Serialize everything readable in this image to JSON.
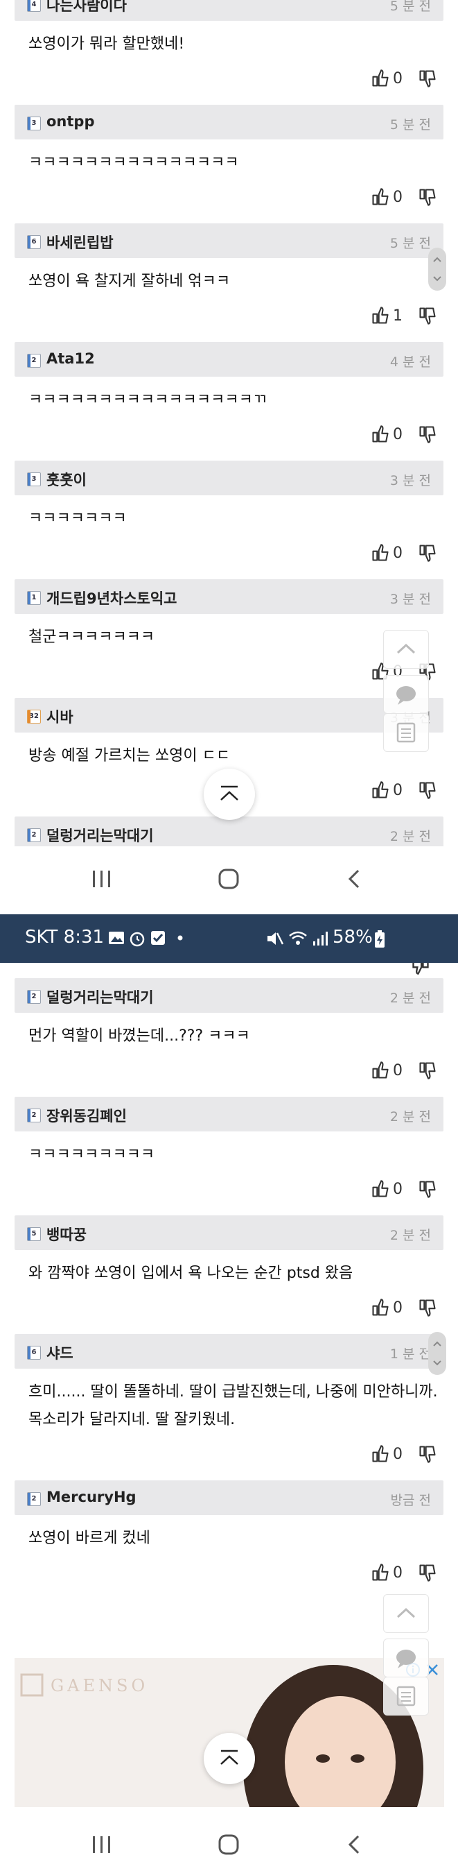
{
  "colors": {
    "statusbar_bg": "#283f5c",
    "header_bg": "#e8e8ea",
    "level_blue": "#4a7fc7",
    "level_orange": "#e68a2e"
  },
  "comments_top": [
    {
      "level": "4",
      "level_color": "blue",
      "nickname": "나는사람이다",
      "time": "5 분 전",
      "text": "쏘영이가 뭐라 할만했네!",
      "likes": "0"
    },
    {
      "level": "3",
      "level_color": "blue",
      "nickname": "ontpp",
      "time": "5 분 전",
      "text": "ㅋㅋㅋㅋㅋㅋㅋㅋㅋㅋㅋㅋㅋㅋㅋ",
      "likes": "0"
    },
    {
      "level": "6",
      "level_color": "blue",
      "nickname": "바세린립밥",
      "time": "5 분 전",
      "text": "쏘영이 욕 찰지게 잘하네 얶ㅋㅋ",
      "likes": "1"
    },
    {
      "level": "2",
      "level_color": "blue",
      "nickname": "Ata12",
      "time": "4 분 전",
      "text": "ㅋㅋㅋㅋㅋㅋㅋㅋㅋㅋㅋㅋㅋㅋㅋㅋㄲ",
      "likes": "0"
    },
    {
      "level": "3",
      "level_color": "blue",
      "nickname": "훗훗이",
      "time": "3 분 전",
      "text": "ㅋㅋㅋㅋㅋㅋㅋ",
      "likes": "0"
    },
    {
      "level": "1",
      "level_color": "blue",
      "nickname": "개드립9년차스토익고",
      "time": "3 분 전",
      "text": "철군ㅋㅋㅋㅋㅋㅋㅋ",
      "likes": "0"
    },
    {
      "level": "32",
      "level_color": "orange",
      "nickname": "시바",
      "time": "3 분 전",
      "text": "방송 예절 가르치는 쏘영이 ㄷㄷ",
      "likes": "0"
    },
    {
      "level": "2",
      "level_color": "blue",
      "nickname": "덜렁거리는막대기",
      "time": "2 분 전",
      "text": "",
      "likes": ""
    }
  ],
  "status_bar": {
    "carrier_time": "SKT 8:31",
    "battery": "58%"
  },
  "comments_bottom": [
    {
      "level": "2",
      "level_color": "blue",
      "nickname": "덜렁거리는막대기",
      "time": "2 분 전",
      "text": "먼가 역할이 바꼈는데...??? ㅋㅋㅋ",
      "likes": "0"
    },
    {
      "level": "2",
      "level_color": "blue",
      "nickname": "장위동김폐인",
      "time": "2 분 전",
      "text": "ㅋㅋㅋㅋㅋㅋㅋㅋㅋ",
      "likes": "0"
    },
    {
      "level": "5",
      "level_color": "blue",
      "nickname": "뱅따꿍",
      "time": "2 분 전",
      "text": "와 깜짝야 쏘영이 입에서 욕 나오는 순간 ptsd 왔음",
      "likes": "0"
    },
    {
      "level": "6",
      "level_color": "blue",
      "nickname": "샤드",
      "time": "1 분 전",
      "text": "흐미...... 딸이 똘똘하네. 딸이 급발진했는데, 나중에 미안하니까. 목소리가 달라지네. 딸 잘키웠네.",
      "likes": "0"
    },
    {
      "level": "2",
      "level_color": "blue",
      "nickname": "MercuryHg",
      "time": "방금 전",
      "text": "쏘영이 바르게 컸네",
      "likes": "0"
    }
  ],
  "ad": {
    "brand": "GAENSO"
  }
}
